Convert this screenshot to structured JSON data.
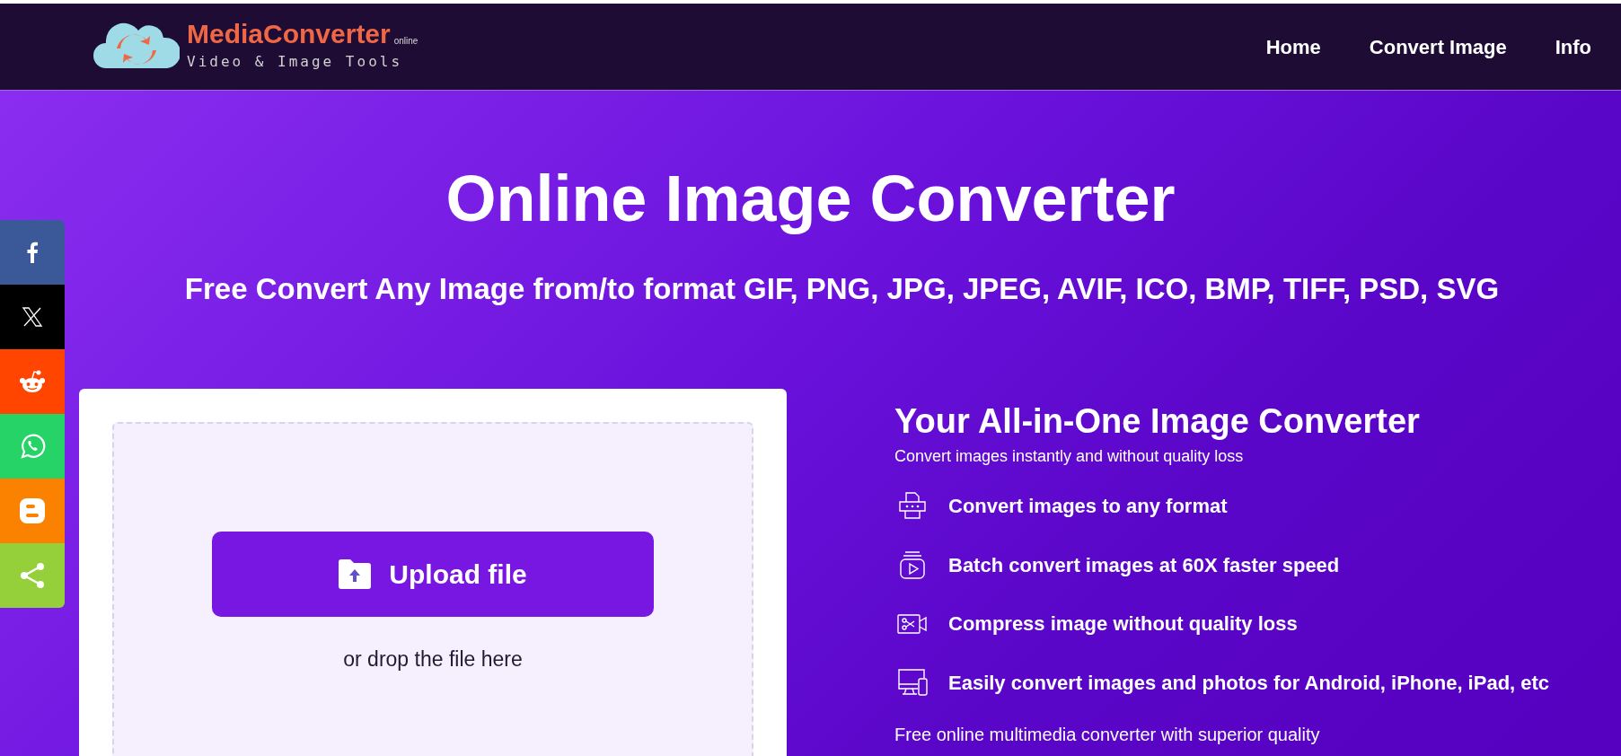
{
  "header": {
    "logo": {
      "name": "MediaConverter",
      "suffix": "online",
      "tagline": "Video & Image Tools"
    },
    "nav": [
      {
        "label": "Home"
      },
      {
        "label": "Convert Image"
      },
      {
        "label": "Info"
      }
    ]
  },
  "share_bar": [
    {
      "kind": "facebook"
    },
    {
      "kind": "x"
    },
    {
      "kind": "reddit"
    },
    {
      "kind": "whatsapp"
    },
    {
      "kind": "blogger"
    },
    {
      "kind": "share"
    }
  ],
  "hero": {
    "title": "Online Image Converter",
    "subtitle": "Free Convert Any Image from/to format GIF, PNG, JPG, JPEG, AVIF, ICO, BMP, TIFF, PSD, SVG"
  },
  "upload": {
    "button": "Upload file",
    "hint": "or drop the file here"
  },
  "info": {
    "heading": "Your All-in-One Image Converter",
    "subheading": "Convert images instantly and without quality loss",
    "features": [
      {
        "kind": "printer",
        "text": "Convert images to any format"
      },
      {
        "kind": "batch",
        "text": "Batch convert images at 60X faster speed"
      },
      {
        "kind": "cut",
        "text": "Compress image without quality loss"
      },
      {
        "kind": "devices",
        "text": "Easily convert images and photos for Android, iPhone, iPad, etc"
      }
    ],
    "footer_text": "Free online multimedia converter with superior quality"
  }
}
